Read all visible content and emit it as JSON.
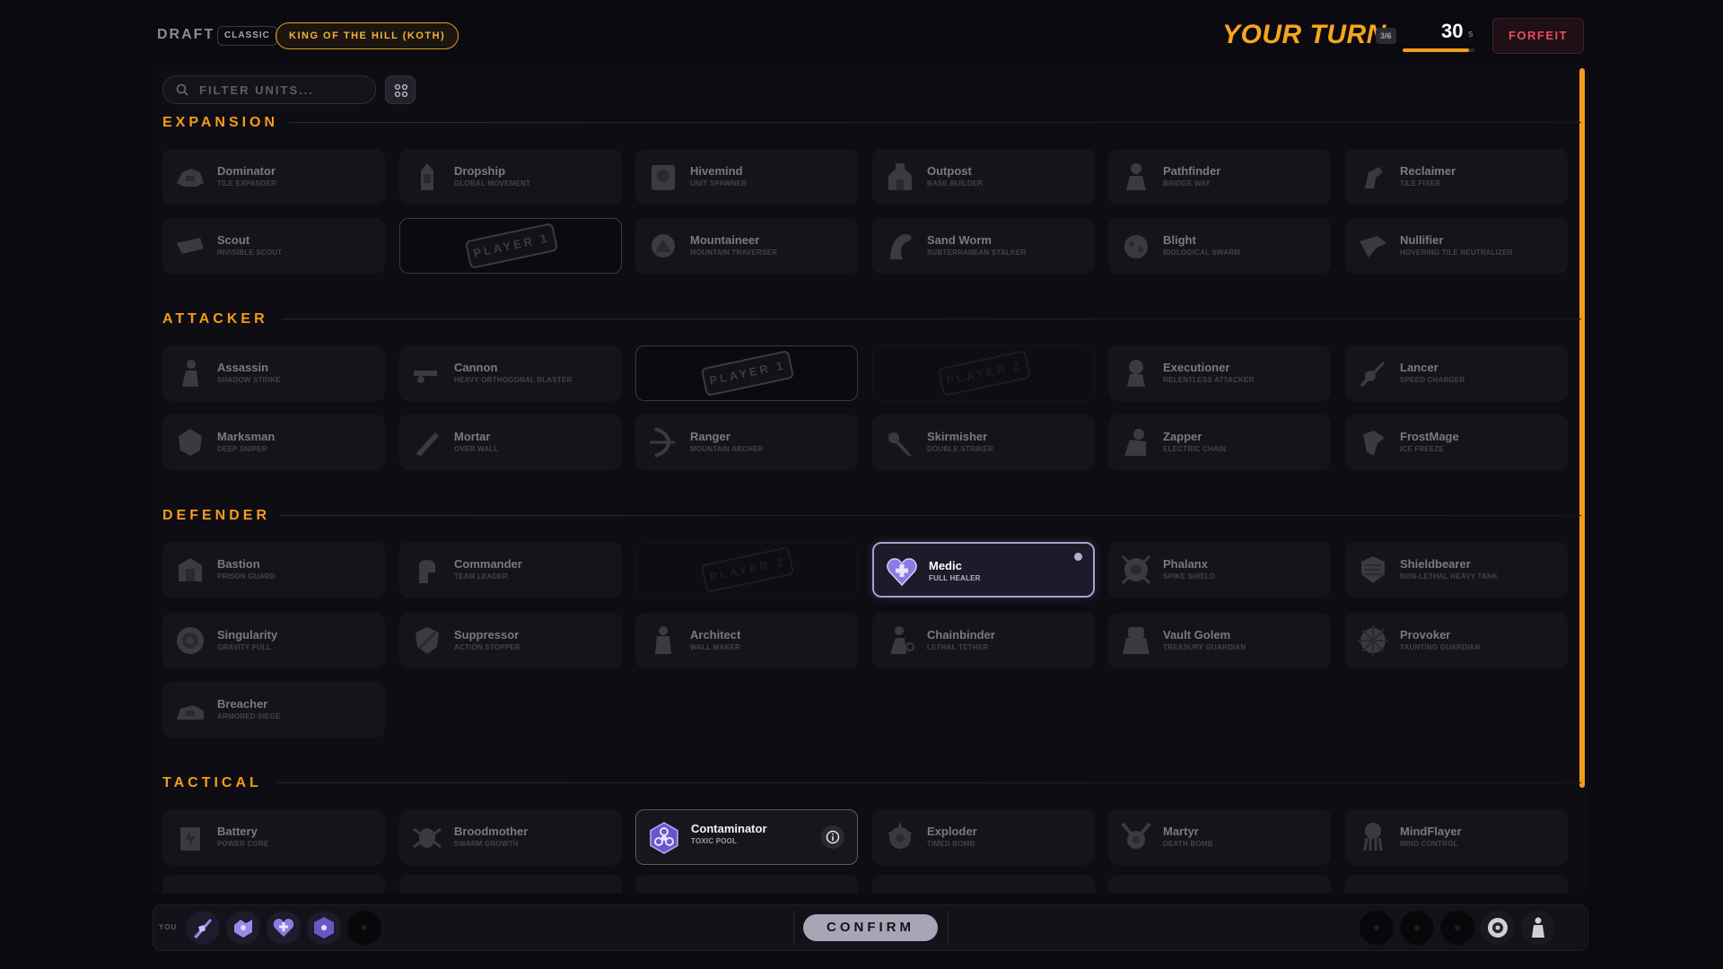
{
  "header": {
    "mode": "DRAFT",
    "variant": "CLASSIC",
    "game_mode": "KING OF THE HILL (KOTH)",
    "your_turn": "YOUR TURN",
    "turn_count": "3/6",
    "timer_value": "30",
    "timer_unit": "s",
    "timer_progress": 0.92,
    "forfeit_label": "FORFEIT"
  },
  "search": {
    "placeholder": "FILTER UNITS..."
  },
  "sections": {
    "expansion": "EXPANSION",
    "attacker": "ATTACKER",
    "defender": "DEFENDER",
    "tactical": "TACTICAL"
  },
  "stamps": {
    "p1": "PLAYER 1",
    "p2": "PLAYER 2"
  },
  "units": {
    "dominator": {
      "name": "Dominator",
      "sub": "TILE EXPANDER"
    },
    "dropship": {
      "name": "Dropship",
      "sub": "GLOBAL MOVEMENT"
    },
    "hivemind": {
      "name": "Hivemind",
      "sub": "UNIT SPAWNER"
    },
    "outpost": {
      "name": "Outpost",
      "sub": "BASE BUILDER"
    },
    "pathfinder": {
      "name": "Pathfinder",
      "sub": "BRIDGE WAY"
    },
    "reclaimer": {
      "name": "Reclaimer",
      "sub": "TILE FIXER"
    },
    "scout": {
      "name": "Scout",
      "sub": "INVISIBLE SCOUT"
    },
    "mountaineer": {
      "name": "Mountaineer",
      "sub": "MOUNTAIN TRAVERSER"
    },
    "sandworm": {
      "name": "Sand Worm",
      "sub": "SUBTERRANEAN STALKER"
    },
    "blight": {
      "name": "Blight",
      "sub": "BIOLOGICAL SWARM"
    },
    "nullifier": {
      "name": "Nullifier",
      "sub": "HOVERING TILE NEUTRALIZER"
    },
    "assassin": {
      "name": "Assassin",
      "sub": "SHADOW STRIKE"
    },
    "cannon": {
      "name": "Cannon",
      "sub": "HEAVY ORTHOGONAL BLASTER"
    },
    "executioner": {
      "name": "Executioner",
      "sub": "RELENTLESS ATTACKER"
    },
    "lancer": {
      "name": "Lancer",
      "sub": "SPEED CHARGER"
    },
    "marksman": {
      "name": "Marksman",
      "sub": "DEEP SNIPER"
    },
    "mortar": {
      "name": "Mortar",
      "sub": "OVER WALL"
    },
    "ranger": {
      "name": "Ranger",
      "sub": "MOUNTAIN ARCHER"
    },
    "skirmisher": {
      "name": "Skirmisher",
      "sub": "DOUBLE STRIKER"
    },
    "zapper": {
      "name": "Zapper",
      "sub": "ELECTRIC CHAIN"
    },
    "frostmage": {
      "name": "FrostMage",
      "sub": "ICE FREEZE"
    },
    "bastion": {
      "name": "Bastion",
      "sub": "PRISON GUARD"
    },
    "commander": {
      "name": "Commander",
      "sub": "TEAM LEADER"
    },
    "medic": {
      "name": "Medic",
      "sub": "FULL HEALER"
    },
    "phalanx": {
      "name": "Phalanx",
      "sub": "SPIKE SHIELD"
    },
    "shieldbearer": {
      "name": "Shieldbearer",
      "sub": "NON-LETHAL HEAVY TANK"
    },
    "singularity": {
      "name": "Singularity",
      "sub": "GRAVITY PULL"
    },
    "suppressor": {
      "name": "Suppressor",
      "sub": "ACTION STOPPER"
    },
    "architect": {
      "name": "Architect",
      "sub": "WALL MAKER"
    },
    "chainbinder": {
      "name": "Chainbinder",
      "sub": "LETHAL TETHER"
    },
    "vaultgolem": {
      "name": "Vault Golem",
      "sub": "TREASURY GUARDIAN"
    },
    "provoker": {
      "name": "Provoker",
      "sub": "TAUNTING GUARDIAN"
    },
    "breacher": {
      "name": "Breacher",
      "sub": "ARMORED SIEGE"
    },
    "battery": {
      "name": "Battery",
      "sub": "POWER CORE"
    },
    "broodmother": {
      "name": "Broodmother",
      "sub": "SWARM GROWTH"
    },
    "contaminator": {
      "name": "Contaminator",
      "sub": "TOXIC POOL"
    },
    "exploder": {
      "name": "Exploder",
      "sub": "TIMED BOMB"
    },
    "martyr": {
      "name": "Martyr",
      "sub": "DEATH BOMB"
    },
    "mindflayer": {
      "name": "MindFlayer",
      "sub": "MIND CONTROL"
    }
  },
  "bottom": {
    "you_label": "YOU",
    "confirm_label": "CONFIRM"
  },
  "colors": {
    "accent": "#f39c1b",
    "forfeit": "#ef4a5e",
    "selected_border": "#a7a2c9"
  }
}
